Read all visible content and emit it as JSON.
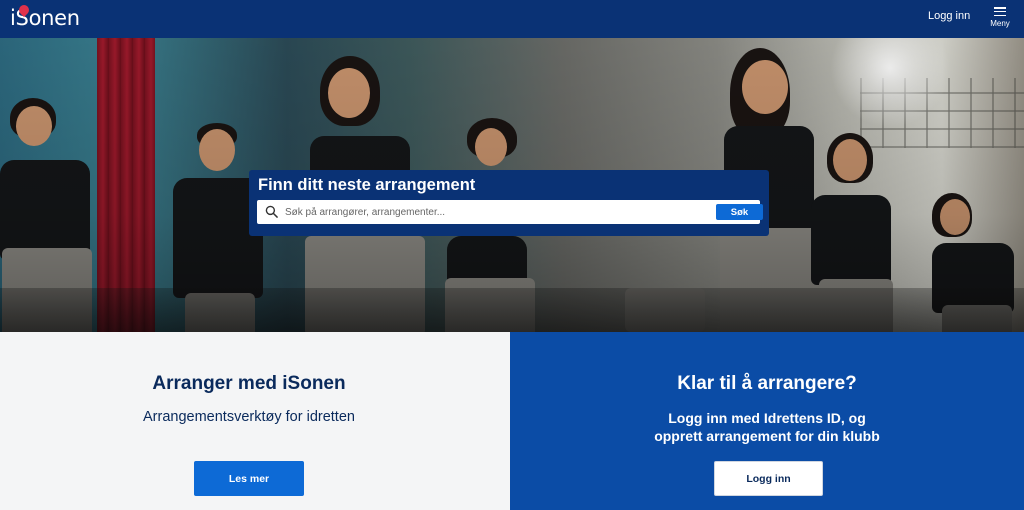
{
  "header": {
    "logo_text": "iSonen",
    "login_link": "Logg inn",
    "menu_label": "Meny",
    "menu_icon": "hamburger-icon"
  },
  "hero": {
    "image_description_icon": "hero-photo",
    "search": {
      "title": "Finn ditt neste arrangement",
      "placeholder": "Søk på arrangører, arrangementer...",
      "button_label": "Søk",
      "icon": "search-icon"
    }
  },
  "left_panel": {
    "heading": "Arranger med iSonen",
    "subheading": "Arrangementsverktøy for idretten",
    "button_label": "Les mer"
  },
  "right_panel": {
    "heading": "Klar til å arrangere?",
    "subheading_line1": "Logg inn med Idrettens ID, og",
    "subheading_line2": "opprett arrangement for din klubb",
    "button_label": "Logg inn"
  },
  "colors": {
    "header_bg": "#0a3275",
    "primary_blue": "#0d6ad6",
    "right_panel_bg": "#0b4ca6",
    "left_panel_bg": "#f4f5f6",
    "logo_pin": "#e0314b"
  }
}
